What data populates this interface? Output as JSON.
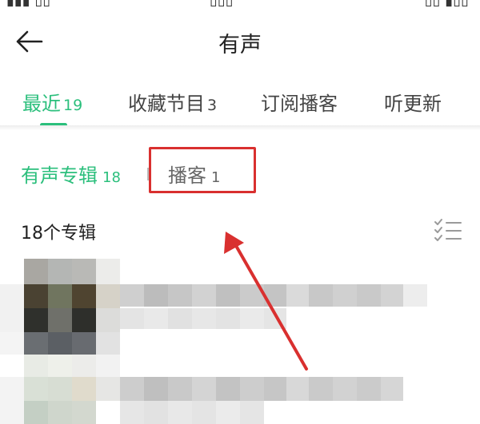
{
  "header": {
    "title": "有声"
  },
  "tabs": [
    {
      "label": "最近",
      "count": "19",
      "active": true
    },
    {
      "label": "收藏节目",
      "count": "3",
      "active": false
    },
    {
      "label": "订阅播客",
      "count": "",
      "active": false
    },
    {
      "label": "听更新",
      "count": "",
      "active": false
    }
  ],
  "subtabs": [
    {
      "label": "有声专辑",
      "count": "18",
      "active": true
    },
    {
      "label": "播客",
      "count": "1",
      "active": false
    }
  ],
  "list": {
    "count_label": "18个专辑"
  },
  "colors": {
    "accent": "#2bbf7c",
    "annotation": "#d9302f"
  },
  "icons": {
    "back": "arrow-left-icon",
    "list_mode": "checklist-icon"
  }
}
